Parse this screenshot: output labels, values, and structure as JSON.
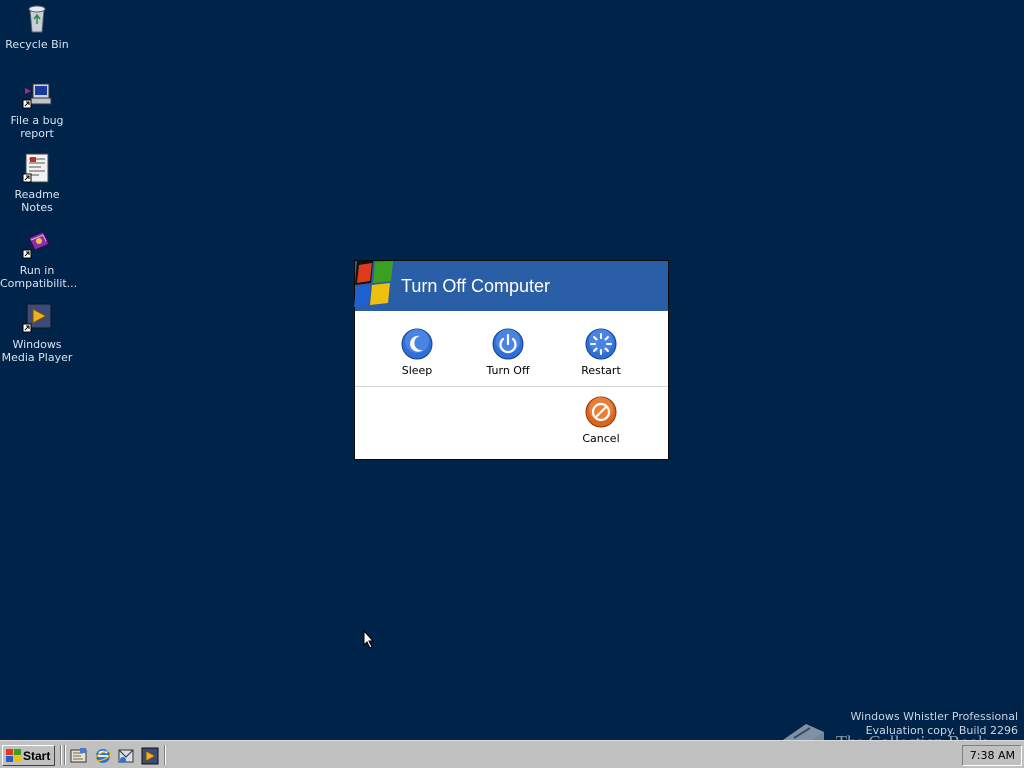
{
  "desktop": {
    "icons": [
      {
        "label": "Recycle Bin",
        "icon": "recycle-bin-icon"
      },
      {
        "label": "File a bug report",
        "icon": "bug-report-icon"
      },
      {
        "label": "Readme Notes",
        "icon": "readme-notes-icon"
      },
      {
        "label": "Run in Compatibilit...",
        "icon": "compatibility-icon"
      },
      {
        "label": "Windows Media Player",
        "icon": "media-player-icon"
      }
    ]
  },
  "dialog": {
    "title": "Turn Off Computer",
    "actions": [
      {
        "label": "Sleep",
        "icon": "sleep-icon",
        "color": "#2f6fd6"
      },
      {
        "label": "Turn Off",
        "icon": "power-icon",
        "color": "#2f6fd6"
      },
      {
        "label": "Restart",
        "icon": "restart-icon",
        "color": "#2f6fd6"
      }
    ],
    "cancel": {
      "label": "Cancel",
      "icon": "cancel-icon",
      "color": "#d9661c"
    }
  },
  "taskbar": {
    "start_label": "Start",
    "quick_launch": [
      "show-desktop-icon",
      "internet-explorer-icon",
      "outlook-icon",
      "media-player-icon"
    ],
    "clock": "7:38 AM"
  },
  "watermark": {
    "line1": "Windows Whistler Professional",
    "line2": "Evaluation copy. Build 2296"
  },
  "brand": "The Collection Book",
  "colors": {
    "desktop": "#00234a",
    "dialog_header": "#2a5fa8",
    "taskbar": "#c0c0c0"
  }
}
